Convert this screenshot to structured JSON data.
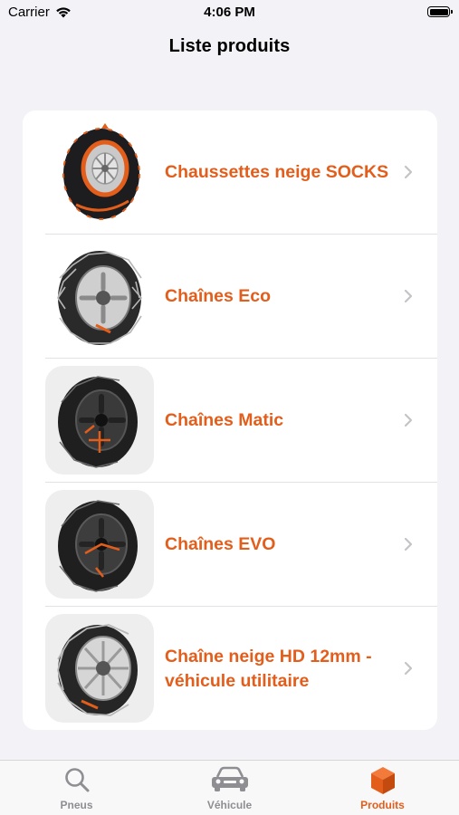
{
  "status_bar": {
    "carrier": "Carrier",
    "time": "4:06 PM",
    "icons": [
      "wifi-icon",
      "battery-icon"
    ]
  },
  "nav": {
    "title": "Liste produits"
  },
  "products": [
    {
      "label": "Chaussettes neige SOCKS",
      "image": "snow-socks-image"
    },
    {
      "label": "Chaînes Eco",
      "image": "snow-chain-eco-image"
    },
    {
      "label": "Chaînes Matic",
      "image": "snow-chain-matic-image"
    },
    {
      "label": "Chaînes EVO",
      "image": "snow-chain-evo-image"
    },
    {
      "label": "Chaîne neige HD 12mm - véhicule utilitaire",
      "image": "snow-chain-hd-image"
    }
  ],
  "tab_bar": {
    "tabs": [
      {
        "label": "Pneus",
        "icon": "search-icon",
        "active": false
      },
      {
        "label": "Véhicule",
        "icon": "car-icon",
        "active": false
      },
      {
        "label": "Produits",
        "icon": "box-icon",
        "active": true
      }
    ]
  },
  "colors": {
    "accent": "#e35d1b",
    "background": "#f2f2f7",
    "card": "#ffffff",
    "tab_inactive": "#8e8e93"
  }
}
